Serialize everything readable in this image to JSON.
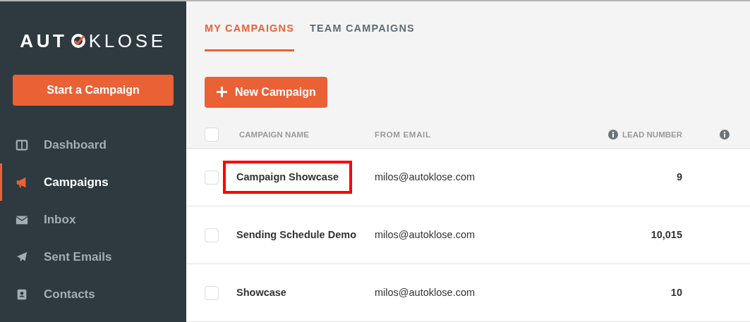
{
  "logo": {
    "left": "AUT",
    "right": "KLOSE"
  },
  "start_button": "Start a Campaign",
  "nav": [
    {
      "label": "Dashboard",
      "kind": "dashboard",
      "selected": false
    },
    {
      "label": "Campaigns",
      "kind": "megaphone",
      "selected": true
    },
    {
      "label": "Inbox",
      "kind": "envelope",
      "selected": false
    },
    {
      "label": "Sent Emails",
      "kind": "plane",
      "selected": false
    },
    {
      "label": "Contacts",
      "kind": "contacts",
      "selected": false
    }
  ],
  "tabs": [
    {
      "label": "MY CAMPAIGNS",
      "selected": true
    },
    {
      "label": "TEAM CAMPAIGNS",
      "selected": false
    }
  ],
  "new_button": "New Campaign",
  "table": {
    "all_checked": false,
    "columns": [
      "CAMPAIGN NAME",
      "FROM EMAIL",
      "LEAD NUMBER"
    ],
    "rows": [
      {
        "name": "Campaign Showcase",
        "email": "milos@autoklose.com",
        "leads": "9",
        "highlighted": true,
        "checked": false
      },
      {
        "name": "Sending Schedule Demo",
        "email": "milos@autoklose.com",
        "leads": "10,015",
        "highlighted": false,
        "checked": false
      },
      {
        "name": "Showcase",
        "email": "milos@autoklose.com",
        "leads": "10",
        "highlighted": false,
        "checked": false
      }
    ]
  }
}
